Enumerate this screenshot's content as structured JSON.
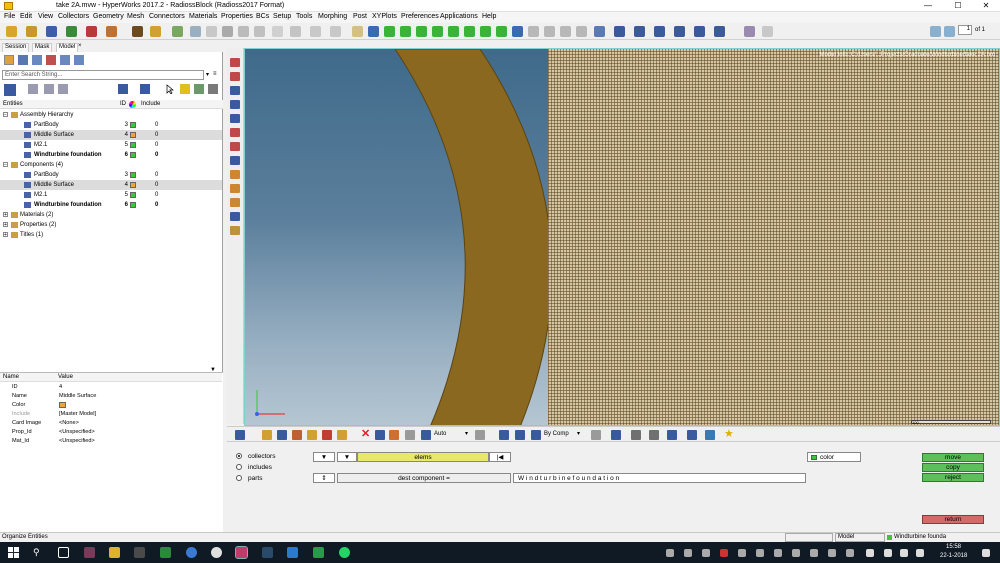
{
  "window": {
    "title": "take 2A.mvw - HyperWorks 2017.2 - RadiossBlock (Radioss2017 Format)",
    "minimize": "—",
    "maximize": "☐",
    "close": "✕"
  },
  "menu": [
    "File",
    "Edit",
    "View",
    "Collectors",
    "Geometry",
    "Mesh",
    "Connectors",
    "Materials",
    "Properties",
    "BCs",
    "Setup",
    "Tools",
    "Morphing",
    "Post",
    "XYPlots",
    "Preferences",
    "Applications",
    "Help"
  ],
  "page": {
    "current": "1",
    "total_label": "of 1"
  },
  "tabs": [
    "Session",
    "Mask",
    "Model"
  ],
  "tab_close": "×",
  "search": {
    "placeholder": "Enter Search String..."
  },
  "entities_header": {
    "entities": "Entities",
    "id": "ID",
    "include": "Include"
  },
  "tree": [
    {
      "label": "Assembly Hierarchy",
      "id": "",
      "include": "",
      "level": 0,
      "expander": "−",
      "bold": false,
      "selected": false,
      "color": ""
    },
    {
      "label": "PartBody",
      "id": "3",
      "include": "0",
      "level": 1,
      "expander": "",
      "bold": false,
      "selected": false,
      "color": "#3ec43e"
    },
    {
      "label": "Middle Surface",
      "id": "4",
      "include": "0",
      "level": 1,
      "expander": "",
      "bold": false,
      "selected": true,
      "color": "#e9a640"
    },
    {
      "label": "M2.1",
      "id": "5",
      "include": "0",
      "level": 1,
      "expander": "",
      "bold": false,
      "selected": false,
      "color": "#3ec43e"
    },
    {
      "label": "Windturbine foundation",
      "id": "6",
      "include": "0",
      "level": 1,
      "expander": "",
      "bold": true,
      "selected": false,
      "color": "#3ec43e"
    },
    {
      "label": "Components (4)",
      "id": "",
      "include": "",
      "level": 0,
      "expander": "−",
      "bold": false,
      "selected": false,
      "color": ""
    },
    {
      "label": "PartBody",
      "id": "3",
      "include": "0",
      "level": 1,
      "expander": "",
      "bold": false,
      "selected": false,
      "color": "#3ec43e"
    },
    {
      "label": "Middle Surface",
      "id": "4",
      "include": "0",
      "level": 1,
      "expander": "",
      "bold": false,
      "selected": true,
      "color": "#e9a640"
    },
    {
      "label": "M2.1",
      "id": "5",
      "include": "0",
      "level": 1,
      "expander": "",
      "bold": false,
      "selected": false,
      "color": "#3ec43e"
    },
    {
      "label": "Windturbine foundation",
      "id": "6",
      "include": "0",
      "level": 1,
      "expander": "",
      "bold": true,
      "selected": false,
      "color": "#3ec43e"
    },
    {
      "label": "Materials (2)",
      "id": "",
      "include": "",
      "level": 0,
      "expander": "+",
      "bold": false,
      "selected": false,
      "color": ""
    },
    {
      "label": "Properties (2)",
      "id": "",
      "include": "",
      "level": 0,
      "expander": "+",
      "bold": false,
      "selected": false,
      "color": ""
    },
    {
      "label": "Titles (1)",
      "id": "",
      "include": "",
      "level": 0,
      "expander": "+",
      "bold": false,
      "selected": false,
      "color": ""
    }
  ],
  "props_header": {
    "name": "Name",
    "value": "Value"
  },
  "props": [
    {
      "k": "ID",
      "v": "4"
    },
    {
      "k": "Name",
      "v": "Middle Surface"
    },
    {
      "k": "Color",
      "v": ""
    },
    {
      "k": "Include",
      "v": "[Master Model]"
    },
    {
      "k": "Card Image",
      "v": "<None>"
    },
    {
      "k": "Prop_Id",
      "v": "<Unspecified>"
    },
    {
      "k": "Mat_Id",
      "v": "<Unspecified>"
    }
  ],
  "graphics": {
    "model_info": "Model Info: C:/Users/...Projects/Graduate/Windturbine/take 2A.hm",
    "scale": "100"
  },
  "bottom_toolbar": {
    "auto": "Auto",
    "by_comp": "By Comp"
  },
  "panel": {
    "collectors": "collectors",
    "includes": "includes",
    "parts": "parts",
    "elems": "elems",
    "dest_component": "dest component =",
    "dest_value": "W i n d t u r b i n e   f o u n d a t i o n",
    "color_label": "color",
    "move": "move",
    "copy": "copy",
    "reject": "reject",
    "return": "return"
  },
  "status": {
    "left": "Organize Entities",
    "model": "Model",
    "comp": "Windturbine founda"
  },
  "clock": {
    "time": "15:58",
    "date": "22-1-2018"
  },
  "colors": {
    "accent_green": "#5cbf5c",
    "accent_red": "#d46a6a",
    "mesh": "#d6c7a0",
    "shell": "#8a6820"
  }
}
